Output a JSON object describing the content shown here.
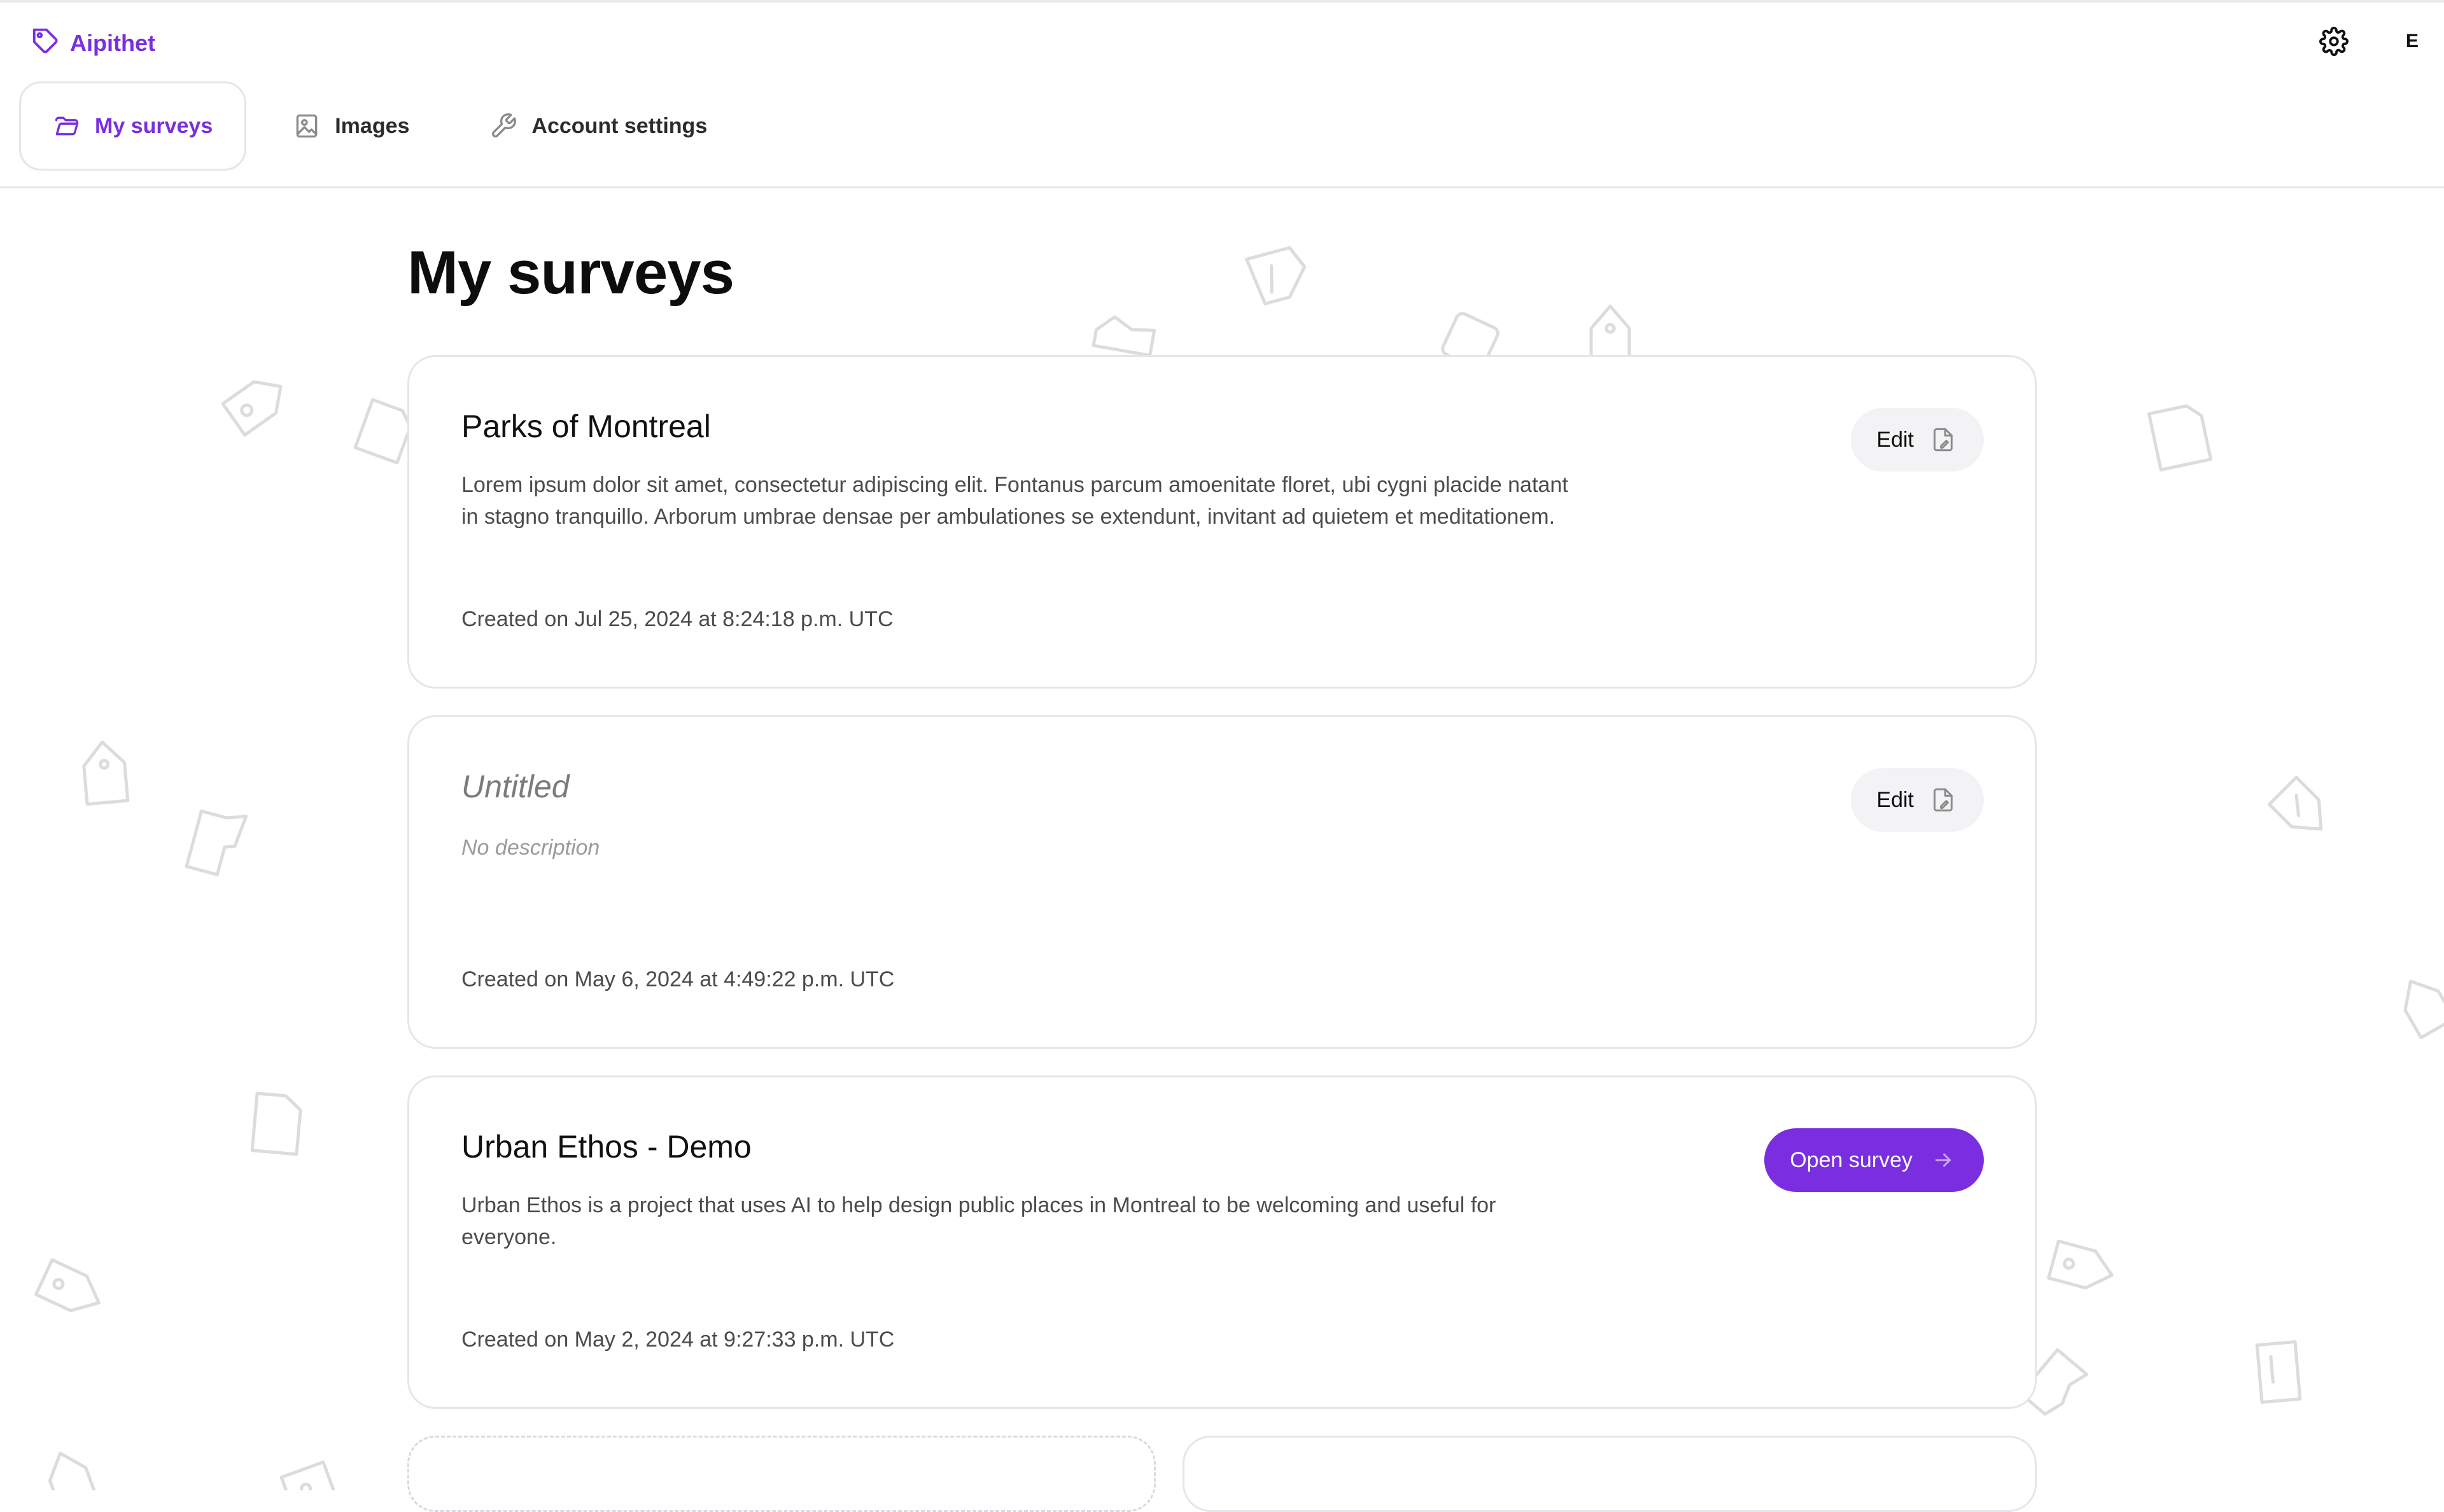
{
  "app": {
    "name": "Aipithet",
    "logo_icon": "tag-icon"
  },
  "header": {
    "settings_icon": "gear-icon",
    "user_initial": "E"
  },
  "tabs": [
    {
      "label": "My surveys",
      "icon": "folder-icon",
      "active": true
    },
    {
      "label": "Images",
      "icon": "image-icon",
      "active": false
    },
    {
      "label": "Account settings",
      "icon": "wrench-icon",
      "active": false
    }
  ],
  "page": {
    "title": "My surveys"
  },
  "surveys": [
    {
      "title": "Parks of Montreal",
      "description": "Lorem ipsum dolor sit amet, consectetur adipiscing elit. Fontanus parcum amoenitate floret, ubi cygni placide natant in stagno tranquillo. Arborum umbrae densae per ambulationes se extendunt, invitant ad quietem et meditationem.",
      "created": "Created on Jul 25, 2024 at 8:24:18 p.m. UTC",
      "action_label": "Edit"
    },
    {
      "title": "Untitled",
      "description": "No description",
      "created": "Created on May 6, 2024 at 4:49:22 p.m. UTC",
      "action_label": "Edit"
    },
    {
      "title": "Urban Ethos - Demo",
      "description": "Urban Ethos is a project that uses AI to help design public places in Montreal to be welcoming and useful for everyone.",
      "created": "Created on May 2, 2024 at 9:27:33 p.m. UTC",
      "action_label": "Open survey"
    }
  ],
  "colors": {
    "accent": "#7a2ee0",
    "border": "#e6e6ea",
    "muted_text": "#4b4b4b"
  }
}
